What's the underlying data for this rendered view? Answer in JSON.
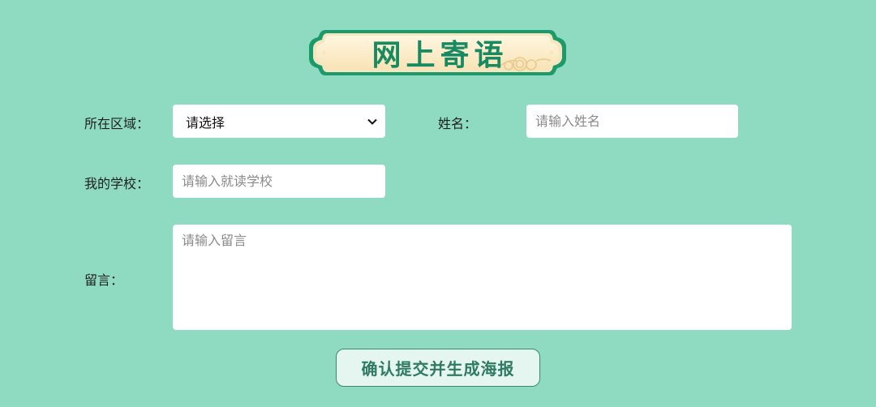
{
  "header": {
    "title": "网上寄语"
  },
  "form": {
    "region": {
      "label": "所在区域：",
      "selected": "请选择",
      "options": [
        "请选择"
      ]
    },
    "name": {
      "label": "姓名：",
      "placeholder": "请输入姓名",
      "value": ""
    },
    "school": {
      "label": "我的学校：",
      "placeholder": "请输入就读学校",
      "value": ""
    },
    "message": {
      "label": "留言：",
      "placeholder": "请输入留言",
      "value": ""
    },
    "submit_label": "确认提交并生成海报"
  },
  "icons": {
    "dropdown": "chevron-down-icon",
    "plaque_ornament": "cloud-swirl-icon"
  },
  "colors": {
    "background": "#8fdbc1",
    "plaque_frame": "#1c9a6c",
    "plaque_fill": "#fdf0d2",
    "title_text": "#178a61",
    "button_text": "#2f7a62"
  }
}
